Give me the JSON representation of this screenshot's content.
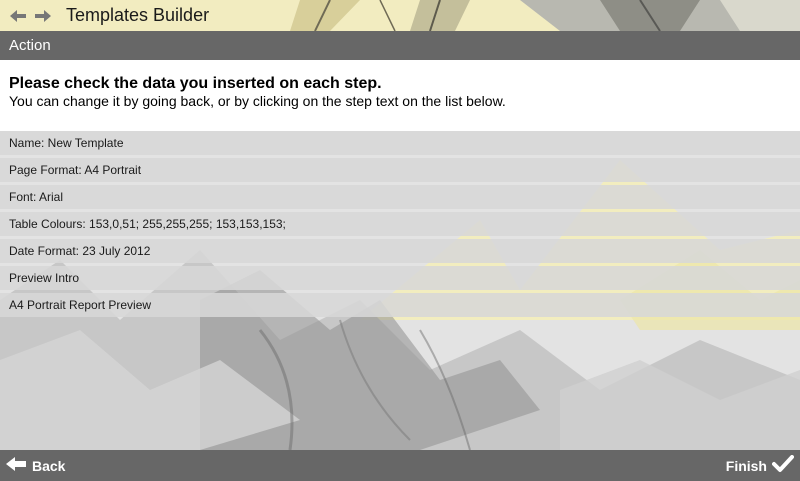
{
  "title_bar": {
    "title": "Templates Builder",
    "back_icon": "arrow-left-icon",
    "forward_icon": "arrow-right-icon"
  },
  "action_bar": {
    "label": "Action"
  },
  "instructions": {
    "heading": "Please check the data you inserted on each step.",
    "text": "You can change it by going back, or by clicking on the step text on the list below."
  },
  "steps": [
    {
      "label": "Name: New Template"
    },
    {
      "label": "Page Format: A4 Portrait"
    },
    {
      "label": "Font: Arial"
    },
    {
      "label": "Table Colours: 153,0,51; 255,255,255; 153,153,153;"
    },
    {
      "label": "Date Format: 23 July 2012"
    },
    {
      "label": "Preview Intro"
    },
    {
      "label": "A4 Portrait Report Preview"
    }
  ],
  "footer": {
    "back_label": "Back",
    "finish_label": "Finish",
    "back_icon": "arrow-left-icon",
    "finish_icon": "checkmark-icon"
  },
  "colors": {
    "bar_gray": "#676767",
    "row_gray": "#d7d7d7",
    "accent_yellow": "#f3eca8"
  }
}
